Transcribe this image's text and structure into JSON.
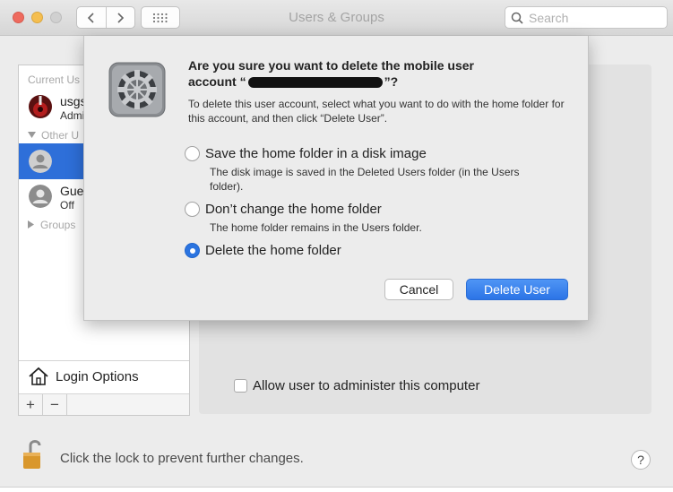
{
  "window": {
    "title": "Users & Groups",
    "search_placeholder": "Search"
  },
  "sidebar": {
    "current_users_header": "Current Us",
    "current_user": {
      "name": "usgs",
      "role": "Admi"
    },
    "other_users_header": "Other U",
    "guest_user": {
      "name": "Gue",
      "status": "Off"
    },
    "groups_header": "Groups",
    "login_options_label": "Login Options",
    "add_label": "+",
    "remove_label": "−"
  },
  "panel": {
    "admin_checkbox_label": "Allow user to administer this computer",
    "admin_checked": false
  },
  "footer": {
    "lock_text": "Click the lock to prevent further changes.",
    "help_label": "?"
  },
  "dialog": {
    "title_line1": "Are you sure you want to delete the mobile user",
    "title_prefix": "account “",
    "title_suffix": "”?",
    "description": "To delete this user account, select what you want to do with the home folder for this account, and then click “Delete User”.",
    "options": [
      {
        "label": "Save the home folder in a disk image",
        "description": "The disk image is saved in the Deleted Users folder (in the Users folder).",
        "selected": false
      },
      {
        "label": "Don’t change the home folder",
        "description": "The home folder remains in the Users folder.",
        "selected": false
      },
      {
        "label": "Delete the home folder",
        "description": "",
        "selected": true
      }
    ],
    "cancel_label": "Cancel",
    "delete_label": "Delete User"
  },
  "colors": {
    "accent": "#2e6fd9",
    "close": "#ee6a5e",
    "minimize": "#f5be4f"
  }
}
